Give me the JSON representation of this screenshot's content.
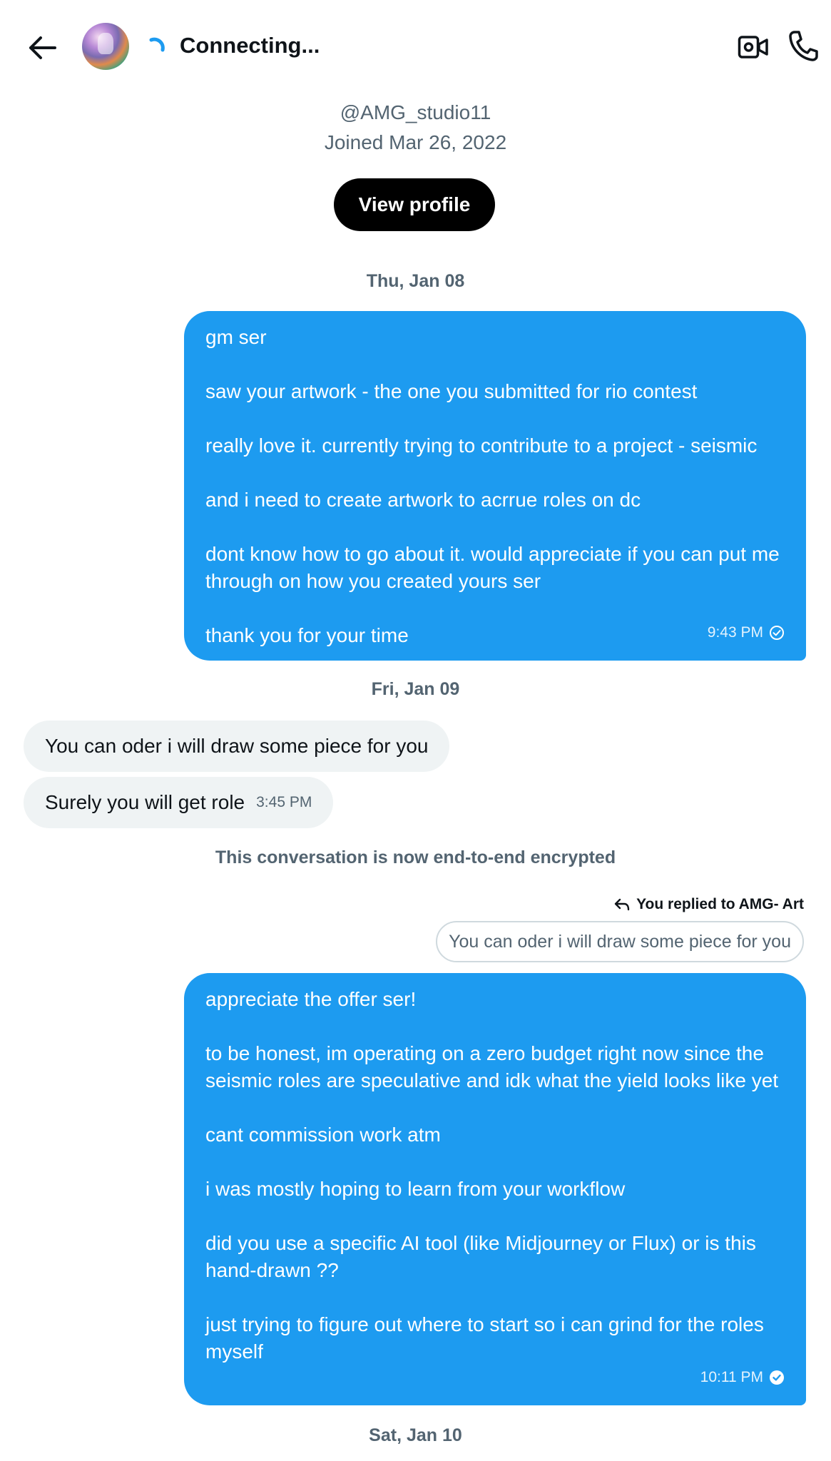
{
  "header": {
    "title": "Connecting...",
    "back_icon": "arrow-left-icon",
    "video_icon": "video-camera-icon",
    "call_icon": "phone-icon",
    "spinner_color": "#1d9bf0"
  },
  "profile": {
    "handle": "@AMG_studio11",
    "joined": "Joined Mar 26, 2022",
    "view_profile_label": "View profile"
  },
  "dates": {
    "d1": "Thu, Jan 08",
    "d2": "Fri, Jan 09",
    "d3": "Sat, Jan 10"
  },
  "messages": {
    "m1": {
      "paragraphs": [
        "gm ser",
        "saw your artwork - the one you submitted for rio contest",
        "really love it. currently trying to contribute to a project - seismic",
        "and i need to create artwork to acrrue roles on dc",
        "dont know how to go about it. would appreciate if you can put me through on how you created yours ser",
        "thank you for your time"
      ],
      "time": "9:43 PM"
    },
    "in1": {
      "text": "You can oder i will draw some piece for you"
    },
    "in2": {
      "text": "Surely you will get role",
      "time": "3:45 PM"
    },
    "encrypted_notice": "This conversation is now end-to-end encrypted",
    "reply": {
      "label": "You replied to AMG- Art",
      "quoted": "You can oder i will draw some piece for you"
    },
    "m2": {
      "paragraphs": [
        "appreciate the offer ser!",
        "to be honest, im operating on a zero budget right now since the seismic roles are speculative and idk what the yield looks like yet",
        "cant commission work atm",
        "i was mostly hoping to learn from your workflow",
        "did you use a specific AI tool (like Midjourney or Flux) or is this hand-drawn ??",
        "just trying to figure out where to start so i can grind for the roles myself"
      ],
      "time": "10:11 PM"
    }
  },
  "colors": {
    "accent": "#1d9bf0",
    "incoming_bubble": "#eff3f4",
    "secondary_text": "#536471"
  }
}
